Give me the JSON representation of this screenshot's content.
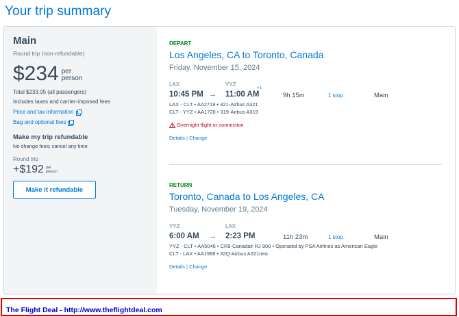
{
  "page": {
    "title": "Your trip summary"
  },
  "fare": {
    "name": "Main",
    "trip_type": "Round trip (non-refundable)",
    "price": "$234",
    "price_unit_1": "per",
    "price_unit_2": "person",
    "total": "Total $233.05 (all passengers)",
    "includes": "Includes taxes and carrier-imposed fees",
    "price_link": "Price and tax information",
    "bag_link": "Bag and optional fees"
  },
  "refund": {
    "title": "Make my trip refundable",
    "subtitle": "No change fees; cancel any time",
    "trip_label": "Round trip",
    "price": "+$192",
    "price_unit_1": "per",
    "price_unit_2": "person",
    "button": "Make it refundable"
  },
  "depart": {
    "label": "DEPART",
    "route": "Los Angeles, CA to Toronto, Canada",
    "date": "Friday, November 15, 2024",
    "from_code": "LAX",
    "to_code": "YYZ",
    "dep_time": "10:45 PM",
    "arrow": "→",
    "arr_time": "11:00 AM",
    "day_offset": "+1",
    "duration": "9h 15m",
    "stops": "1 stop",
    "cabin": "Main",
    "legs": [
      "LAX - CLT • AA2719 • 321-Airbus A321",
      "CLT - YYZ • AA1720 • 319-Airbus A319"
    ],
    "warning": "Overnight flight or connection",
    "details": "Details",
    "separator": "|",
    "change": "Change"
  },
  "return": {
    "label": "RETURN",
    "route": "Toronto, Canada to Los Angeles, CA",
    "date": "Tuesday, November 19, 2024",
    "from_code": "YYZ",
    "to_code": "LAX",
    "dep_time": "6:00 AM",
    "arrow": "→",
    "arr_time": "2:23 PM",
    "duration": "11h 23m",
    "stops": "1 stop",
    "cabin": "Main",
    "legs": [
      "YYZ - CLT • AA5046 • CR9-Canadair RJ 900 • Operated by PSA Airlines as American Eagle",
      "CLT - LAX • AA1988 • 32Q-Airbus A321neo"
    ],
    "details": "Details",
    "separator": "|",
    "change": "Change"
  },
  "banner": {
    "text": "The Flight Deal - http://www.theflightdeal.com"
  },
  "colors": {
    "accent": "#0078d2",
    "text": "#36495a",
    "green_label": "#008a18",
    "warning_red": "#c30019",
    "banner_border": "#e00000",
    "banner_text": "#0000cc",
    "sidebar_bg": "#f2f4f6"
  },
  "icons": {
    "external_link": "external-link-icon",
    "warning": "warning-icon",
    "arrow": "arrow-right-icon"
  }
}
